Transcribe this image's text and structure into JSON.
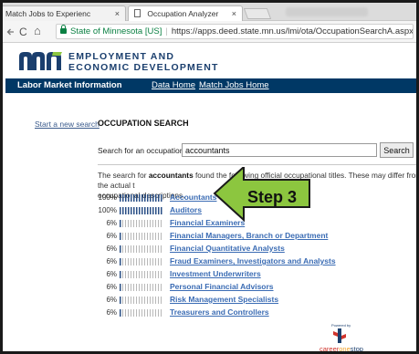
{
  "browser": {
    "tabs": [
      {
        "label": "Match Jobs to Experienc"
      },
      {
        "label": "Occupation Analyzer"
      }
    ],
    "tab_close_glyph": "×",
    "nav": {
      "back_icon": "back-arrow-icon",
      "reload_glyph": "C",
      "home_glyph": "⌂"
    },
    "address": {
      "site_id": "State of Minnesota [US]",
      "separator": "|",
      "url": "https://apps.deed.state.mn.us/lmi/ota/OccupationSearchA.aspx"
    }
  },
  "header": {
    "org_line1": "EMPLOYMENT AND",
    "org_line2": "ECONOMIC DEVELOPMENT",
    "brand_color": "#003865"
  },
  "nav": {
    "title": "Labor Market Information",
    "links": [
      "Data Home",
      "Match Jobs Home"
    ]
  },
  "sidebar": {
    "new_search_link": "Start a new search"
  },
  "main": {
    "section_title": "OCCUPATION SEARCH",
    "search_label": "Search for an occupation",
    "search_value": "accountants",
    "search_button": "Search",
    "result_prefix": "The search for ",
    "result_term": "accountants",
    "result_suffix": " found the following official occupational titles. These may differ from the actual t",
    "result_line2": "occupational descriptions.",
    "results": [
      {
        "pct": "100%",
        "match": 1.0,
        "title": "Accountants"
      },
      {
        "pct": "100%",
        "match": 1.0,
        "title": "Auditors"
      },
      {
        "pct": "6%",
        "match": 0.06,
        "title": "Financial Examiners"
      },
      {
        "pct": "6%",
        "match": 0.06,
        "title": "Financial Managers, Branch or Department"
      },
      {
        "pct": "6%",
        "match": 0.06,
        "title": "Financial Quantitative Analysts"
      },
      {
        "pct": "6%",
        "match": 0.06,
        "title": "Fraud Examiners, Investigators and Analysts"
      },
      {
        "pct": "6%",
        "match": 0.06,
        "title": "Investment Underwriters"
      },
      {
        "pct": "6%",
        "match": 0.06,
        "title": "Personal Financial Advisors"
      },
      {
        "pct": "6%",
        "match": 0.06,
        "title": "Risk Management Specialists"
      },
      {
        "pct": "6%",
        "match": 0.06,
        "title": "Treasurers and Controllers"
      }
    ],
    "link_color": "#3b6cb4"
  },
  "annotation": {
    "label": "Step 3",
    "fill_color": "#8cc63f"
  },
  "footer": {
    "powered_by": "Powered by",
    "logo_career": "career",
    "logo_one": "one",
    "logo_stop": "stop"
  }
}
